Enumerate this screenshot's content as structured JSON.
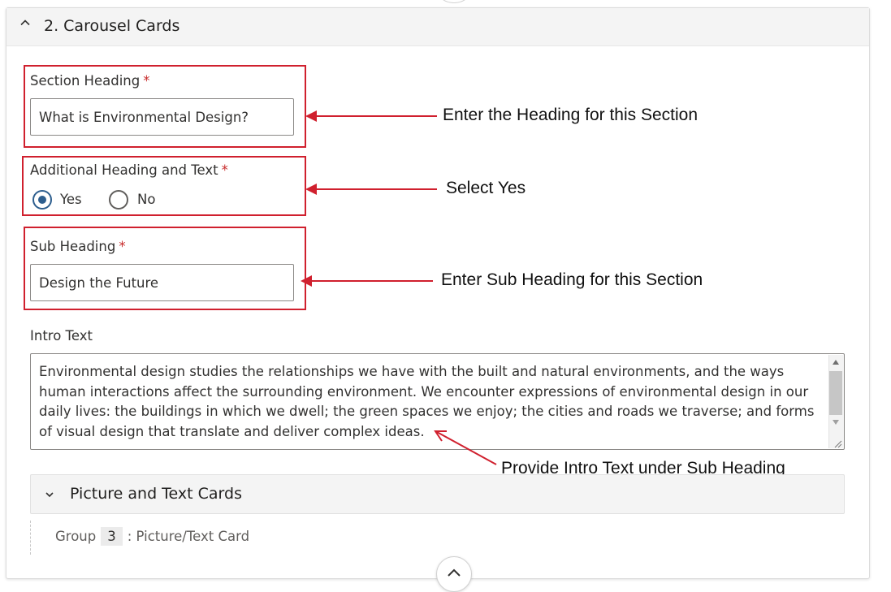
{
  "section": {
    "title": "2. Carousel Cards"
  },
  "fields": {
    "section_heading": {
      "label": "Section Heading",
      "required_mark": "*",
      "value": "What is Environmental Design?"
    },
    "additional": {
      "label": "Additional Heading and Text",
      "required_mark": "*",
      "options": [
        "Yes",
        "No"
      ],
      "selected": "Yes"
    },
    "sub_heading": {
      "label": "Sub Heading",
      "required_mark": "*",
      "value": "Design the Future"
    },
    "intro": {
      "label": "Intro Text",
      "value": "Environmental design studies the relationships we have with the built and natural environments, and the ways human interactions affect the surrounding environment. We encounter expressions of environmental design in our daily lives: the buildings in which we dwell; the green spaces we enjoy; the cities and roads we traverse; and forms of visual design that translate and deliver complex ideas."
    }
  },
  "annotations": {
    "heading": "Enter the Heading for this Section",
    "yes": "Select Yes",
    "sub_heading": "Enter Sub Heading for this Section",
    "intro": "Provide Intro Text under Sub Heading"
  },
  "cards_panel": {
    "title": "Picture and Text Cards",
    "group_label": "Group",
    "group_number": "3",
    "group_suffix": ": Picture/Text Card"
  },
  "icons": {
    "header_toggle": "chevron-up-icon",
    "panel_toggle": "chevron-down-icon",
    "scroll_top": "chevron-up-icon"
  },
  "colors": {
    "annotation_red": "#d0202e",
    "radio_selected": "#2d5e8e",
    "required_asterisk": "#c72a2a"
  }
}
